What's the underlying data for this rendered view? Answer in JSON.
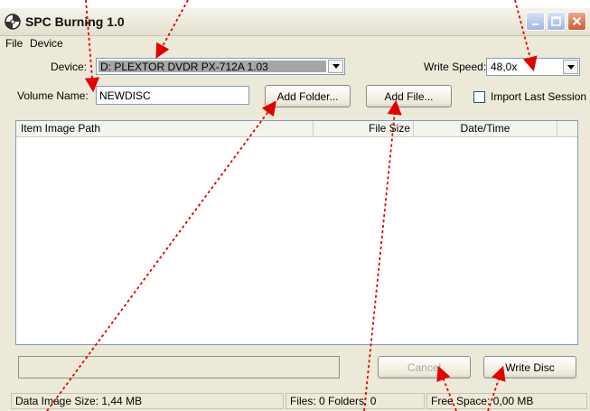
{
  "window": {
    "title": "SPC Burning 1.0"
  },
  "menu": [
    "File",
    "Device"
  ],
  "device": {
    "label": "Device:",
    "value": "D: PLEXTOR DVDR   PX-712A 1.03"
  },
  "write_speed": {
    "label": "Write Speed:",
    "value": "48,0x"
  },
  "volume": {
    "label": "Volume Name:",
    "value": "NEWDISC"
  },
  "buttons": {
    "add_folder": "Add Folder...",
    "add_file": "Add File...",
    "cancel": "Cancel",
    "write_disc": "Write Disc"
  },
  "import_last_session": {
    "label": "Import Last Session",
    "checked": false
  },
  "list": {
    "columns": [
      "Item Image Path",
      "File Size",
      "Date/Time"
    ],
    "rows": []
  },
  "progress": {
    "value": 0
  },
  "status": {
    "data_size": "Data Image Size: 1,44 MB",
    "files": "Files: 0 Folders: 0",
    "free_space": "Free Space: 0,00 MB"
  },
  "colors": {
    "annotation_arrow": "#e00000",
    "close_button": "#cf5a36",
    "title_gradient": "#e3dfcf"
  }
}
